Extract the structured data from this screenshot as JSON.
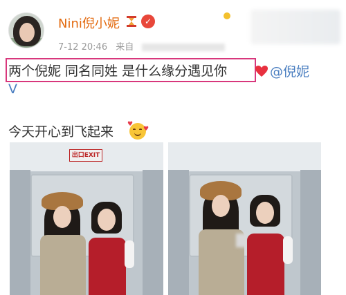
{
  "post": {
    "username": "Nini倪小妮",
    "timestamp": "7-12 20:46",
    "source_prefix": "来自",
    "text_line1": "两个倪妮 同名同姓 是什么缘分遇见你",
    "mention": "@倪妮",
    "mention_suffix": "V",
    "text_line2": "今天开心到飞起来",
    "exit_sign": "出口EXIT"
  },
  "icons": [
    "vip-icon",
    "verified-icon",
    "heart-icon",
    "smiling-face-with-hearts-icon"
  ],
  "colors": {
    "username": "#e36a0f",
    "mention": "#4a7ec0",
    "highlight_box": "#d8377c",
    "uniform_red": "#b51e2a"
  }
}
